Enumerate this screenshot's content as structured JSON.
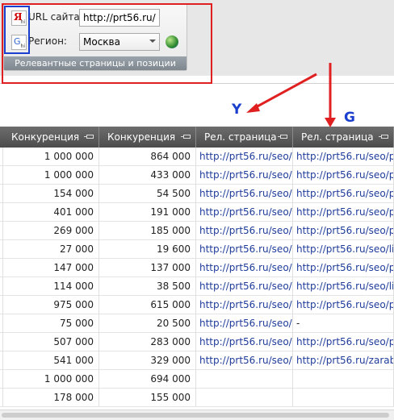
{
  "ribbon": {
    "url_label": "URL сайта:",
    "url_value": "http://prt56.ru/",
    "region_label": "Регион:",
    "region_value": "Москва",
    "group_caption": "Релевантные страницы и позиции",
    "icons": [
      "yandex-icon",
      "google-icon",
      "globe-icon"
    ]
  },
  "annotations": {
    "y_label": "Y",
    "g_label": "G",
    "colors": {
      "box": "#e02020",
      "blue_box": "#1a3fcf",
      "labels": "#1a3fcf"
    }
  },
  "grid": {
    "columns": [
      "Конкуренция",
      "Конкуренция",
      "Рел. страница",
      "Рел. страница"
    ],
    "rows": [
      [
        "1 000 000",
        "864 000",
        "http://prt56.ru/seo/p",
        "http://prt56.ru/seo/p"
      ],
      [
        "1 000 000",
        "433 000",
        "http://prt56.ru/seo/p",
        "http://prt56.ru/seo/p"
      ],
      [
        "154 000",
        "54 500",
        "http://prt56.ru/seo/p",
        "http://prt56.ru/seo/p"
      ],
      [
        "401 000",
        "191 000",
        "http://prt56.ru/seo/p",
        "http://prt56.ru/seo/p"
      ],
      [
        "269 000",
        "185 000",
        "http://prt56.ru/seo/p",
        "http://prt56.ru/seo/p"
      ],
      [
        "27 000",
        "19 600",
        "http://prt56.ru/seo/p",
        "http://prt56.ru/seo/li"
      ],
      [
        "147 000",
        "137 000",
        "http://prt56.ru/seo/p",
        "http://prt56.ru/seo/p"
      ],
      [
        "114 000",
        "38 500",
        "http://prt56.ru/seo/p",
        "http://prt56.ru/seo/li"
      ],
      [
        "975 000",
        "615 000",
        "http://prt56.ru/seo/p",
        "http://prt56.ru/seo/p"
      ],
      [
        "75 000",
        "20 500",
        "http://prt56.ru/seo/p",
        "-"
      ],
      [
        "507 000",
        "283 000",
        "http://prt56.ru/seo/p",
        "http://prt56.ru/seo/p"
      ],
      [
        "541 000",
        "329 000",
        "http://prt56.ru/seo/p",
        "http://prt56.ru/zarab"
      ],
      [
        "1 000 000",
        "694 000",
        "",
        ""
      ],
      [
        "178 000",
        "155 000",
        "",
        ""
      ]
    ]
  }
}
